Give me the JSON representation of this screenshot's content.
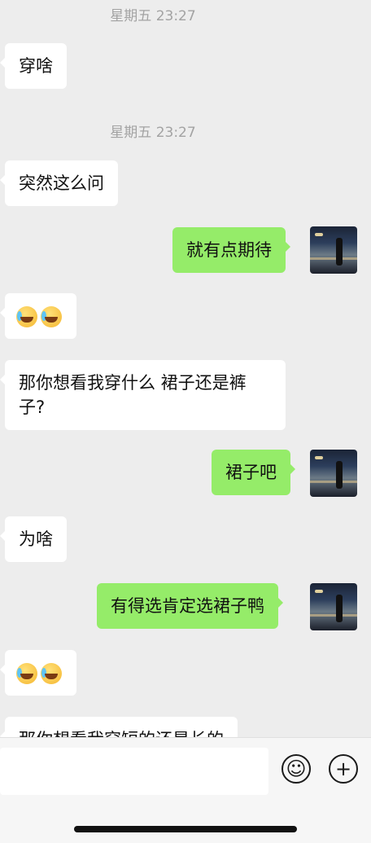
{
  "timestamps": [
    "星期五 23:27",
    "星期五 23:27"
  ],
  "messages": [
    {
      "side": "left",
      "text": "穿啥"
    },
    {
      "side": "left",
      "text": "突然这么问"
    },
    {
      "side": "right",
      "text": "就有点期待"
    },
    {
      "side": "left",
      "emoji": [
        "laugh-cry-emoji",
        "laugh-cry-emoji"
      ]
    },
    {
      "side": "left",
      "text": "那你想看我穿什么 裙子还是裤子?"
    },
    {
      "side": "right",
      "text": "裙子吧"
    },
    {
      "side": "left",
      "text": "为啥"
    },
    {
      "side": "right",
      "text": "有得选肯定选裙子鸭"
    },
    {
      "side": "left",
      "emoji": [
        "laugh-cry-emoji",
        "laugh-cry-emoji"
      ]
    },
    {
      "side": "left",
      "text": "那你想看我穿短的还是长的"
    }
  ],
  "input_bar": {
    "placeholder": "",
    "emoji_button_icon": "smiley-icon",
    "plus_button_icon": "plus-icon",
    "plus_glyph": "+",
    "emoji_glyph": "☺"
  },
  "colors": {
    "background": "#ededed",
    "bubble_left": "#ffffff",
    "bubble_right": "#95ec69",
    "timestamp": "#a3a3a3"
  }
}
